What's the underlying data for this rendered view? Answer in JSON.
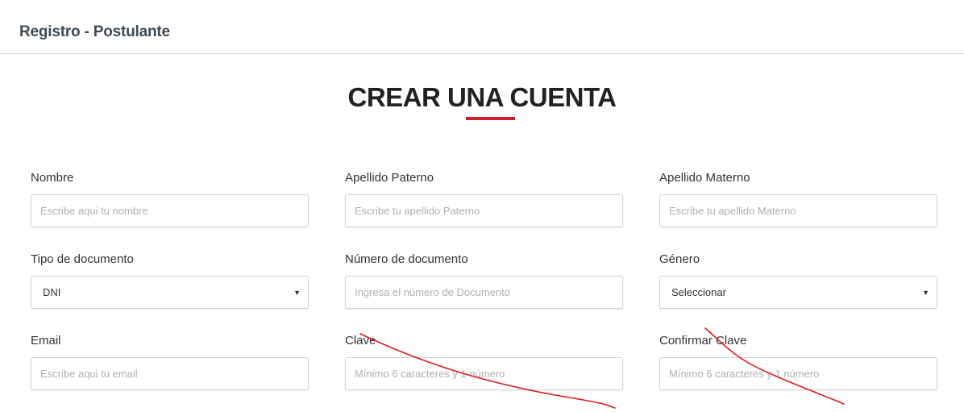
{
  "header": {
    "title": "Registro - Postulante"
  },
  "page": {
    "heading": "CREAR UNA CUENTA",
    "accent_color": "#cc1e2d"
  },
  "form": {
    "nombre": {
      "label": "Nombre",
      "placeholder": "Escribe aqui tu nombre"
    },
    "apellido_paterno": {
      "label": "Apellido Paterno",
      "placeholder": "Escribe tu apellido Paterno"
    },
    "apellido_materno": {
      "label": "Apellido Materno",
      "placeholder": "Escribe tu apellido Materno"
    },
    "tipo_documento": {
      "label": "Tipo de documento",
      "value": "DNI"
    },
    "numero_documento": {
      "label": "Número de documento",
      "placeholder": "Ingresa el número de Documento"
    },
    "genero": {
      "label": "Género",
      "value": "Seleccionar"
    },
    "email": {
      "label": "Email",
      "placeholder": "Escribe aqui tu email"
    },
    "clave": {
      "label": "Clave",
      "placeholder": "Mínimo 6 caracteres y 1 número"
    },
    "confirmar_clave": {
      "label": "Confirmar Clave",
      "placeholder": "Mínimo 6 caracteres y 1 número"
    }
  },
  "icons": {
    "dropdown": "caret-down-icon"
  },
  "annotations": {
    "color": "#e31919"
  }
}
